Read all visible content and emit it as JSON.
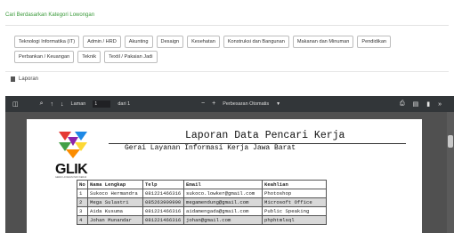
{
  "filter": {
    "title": "Cari Berdasarkan Kategori Lowongan",
    "categories": [
      "Teknologi Informatika (IT)",
      "Admin / HRD",
      "Akunting",
      "Desaign",
      "Kesehatan",
      "Konstruksi dan Bangunan",
      "Makanan dan Minuman",
      "Pendidikan",
      "Perbankan / Keuangan",
      "Teknik",
      "Textil / Pakaian Jadi"
    ]
  },
  "section": {
    "label": "Laporan",
    "icon": "document-icon"
  },
  "viewer": {
    "page_label": "Laman",
    "page_value": "1",
    "page_total": "dari 1",
    "zoom_label": "Perbesaran Otomatis"
  },
  "report": {
    "title": "Laporan Data Pencari Kerja",
    "subtitle": "Gerai Layanan Informasi Kerja Jawa Barat",
    "logo_text": "GLIK",
    "logo_sub": "GERAI LAYANAN INFO KERJA",
    "columns": [
      "No",
      "Nama Lengkap",
      "Telp",
      "Email",
      "Keahlian"
    ],
    "rows": [
      [
        "1",
        "Sukoco Hermandra",
        "081221466316",
        "sukoco.lowker@gmail.com",
        "Photoshop"
      ],
      [
        "2",
        "Mega Sulastri",
        "085263909990",
        "megamendung@gmail.com",
        "Microsoft Office"
      ],
      [
        "3",
        "Aida Kusuma",
        "081221466316",
        "aidamengada@gmail.com",
        "Public Speaking"
      ],
      [
        "4",
        "Johan Munandar",
        "081221466316",
        "johan@gmail.com",
        "phphtmlsql"
      ]
    ]
  },
  "colors": {
    "accent_green": "#3a9a3a",
    "toolbar": "#323639",
    "viewer_bg": "#505050"
  }
}
